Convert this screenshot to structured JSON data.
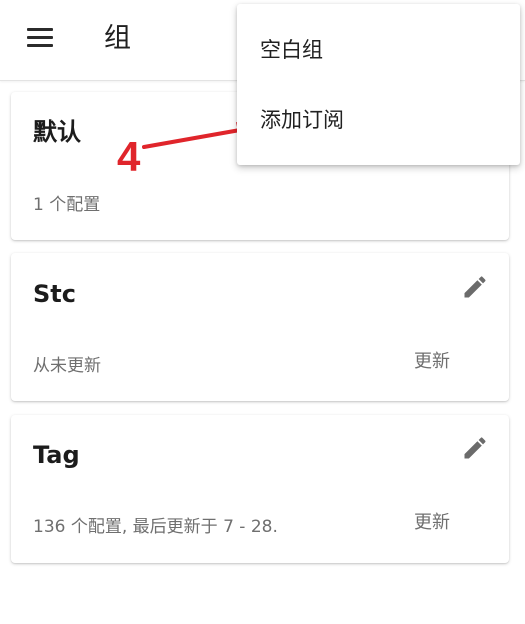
{
  "app_bar": {
    "title": "组",
    "menu_icon": "hamburger-menu-icon"
  },
  "groups": [
    {
      "title": "默认",
      "subtitle": "1 个配置"
    },
    {
      "title": "Stc",
      "subtitle": "从未更新",
      "action_label": "更新",
      "edit_icon": "pencil-icon"
    },
    {
      "title": "Tag",
      "subtitle": "136 个配置, 最后更新于 7 - 28.",
      "action_label": "更新",
      "edit_icon": "pencil-icon"
    }
  ],
  "dropdown_menu": {
    "items": [
      {
        "label": "空白组"
      },
      {
        "label": "添加订阅"
      }
    ]
  },
  "annotation": {
    "step_number": "4",
    "color": "#e0252b"
  },
  "colors": {
    "icon": "#6b6b6b",
    "subtitle": "#6f6f6f"
  }
}
